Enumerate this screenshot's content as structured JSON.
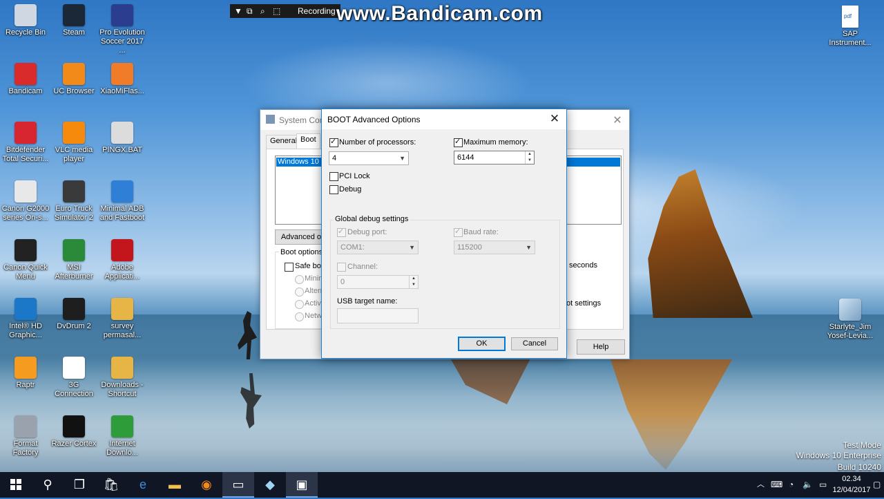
{
  "desktop_icons": [
    {
      "label": "Recycle Bin",
      "icon": "recycle-bin-icon",
      "color": "#cfd8e2"
    },
    {
      "label": "Steam",
      "icon": "steam-icon",
      "color": "#1b2838"
    },
    {
      "label": "Pro Evolution Soccer 2017 ...",
      "icon": "pes-icon",
      "color": "#2b3d8f"
    },
    {
      "label": "Bandicam",
      "icon": "bandicam-icon",
      "color": "#d92b2b"
    },
    {
      "label": "UC Browser",
      "icon": "uc-browser-icon",
      "color": "#f28a1a"
    },
    {
      "label": "XiaoMiFlas...",
      "icon": "xiaomi-icon",
      "color": "#f07c2a"
    },
    {
      "label": "Bitdefender Total Securi...",
      "icon": "bitdefender-icon",
      "color": "#d7262f"
    },
    {
      "label": "VLC media player",
      "icon": "vlc-icon",
      "color": "#f58a0c"
    },
    {
      "label": "PINGX.BAT",
      "icon": "bat-file-icon",
      "color": "#dcdcdc"
    },
    {
      "label": "Canon G2000 series On-s...",
      "icon": "canon-icon",
      "color": "#e8e8e8"
    },
    {
      "label": "Euro Truck Simulator 2",
      "icon": "truck-icon",
      "color": "#3a3a3a"
    },
    {
      "label": "Minimal ADB and Fastboot",
      "icon": "adb-icon",
      "color": "#2f7fd6"
    },
    {
      "label": "Canon Quick Menu",
      "icon": "canon-quick-icon",
      "color": "#222222"
    },
    {
      "label": "MSI Afterburner",
      "icon": "msi-icon",
      "color": "#2a8a3a"
    },
    {
      "label": "Adobe Applicati...",
      "icon": "adobe-icon",
      "color": "#c3161c"
    },
    {
      "label": "Intel® HD Graphic...",
      "icon": "intel-icon",
      "color": "#1b78c8"
    },
    {
      "label": "DvDrum 2",
      "icon": "dvdrum-icon",
      "color": "#1e1e1e"
    },
    {
      "label": "survey permasal...",
      "icon": "folder-icon",
      "color": "#e6b545"
    },
    {
      "label": "Raptr",
      "icon": "raptr-icon",
      "color": "#f59b1f"
    },
    {
      "label": "3G Connection",
      "icon": "3g-icon",
      "color": "#ffffff"
    },
    {
      "label": "Downloads - Shortcut",
      "icon": "downloads-folder-icon",
      "color": "#e6b545"
    },
    {
      "label": "Format Factory",
      "icon": "format-factory-icon",
      "color": "#9aa3ad"
    },
    {
      "label": "Razer Cortex",
      "icon": "razer-icon",
      "color": "#111111"
    },
    {
      "label": "Internet Downlo...",
      "icon": "idm-icon",
      "color": "#2f9c3a"
    }
  ],
  "right_icons": [
    {
      "label": "SAP Instrument...",
      "icon": "pdf-file-icon"
    },
    {
      "label": "Starlyte_Jim Yosef-Levia...",
      "icon": "image-file-icon"
    }
  ],
  "recording": {
    "label": "Recording",
    "watermark": "www.Bandicam.com"
  },
  "sysconfig": {
    "title": "System Conf",
    "tabs": [
      "General",
      "Boot"
    ],
    "os_entry": "Windows 10 (C",
    "advanced_button": "Advanced op",
    "boot_options_label": "Boot options",
    "safe_boot": "Safe boo",
    "radios": [
      "Minima",
      "Altern",
      "Active",
      "Netwo"
    ],
    "seconds_label": "seconds",
    "boot_settings_label": "ot settings",
    "help_button": "Help"
  },
  "boot_dialog": {
    "title": "BOOT Advanced Options",
    "num_processors_label": "Number of processors:",
    "num_processors_checked": true,
    "num_processors_value": "4",
    "max_memory_label": "Maximum memory:",
    "max_memory_checked": true,
    "max_memory_value": "6144",
    "pci_lock_label": "PCI Lock",
    "debug_label": "Debug",
    "global_debug_title": "Global debug settings",
    "debug_port_label": "Debug port:",
    "debug_port_value": "COM1:",
    "baud_rate_label": "Baud rate:",
    "baud_rate_value": "115200",
    "channel_label": "Channel:",
    "channel_value": "0",
    "usb_target_label": "USB target name:",
    "ok_button": "OK",
    "cancel_button": "Cancel"
  },
  "os_watermark": {
    "line1": "Test Mode",
    "line2": "Windows 10 Enterprise",
    "line3": "Build 10240"
  },
  "taskbar": {
    "time": "02.34",
    "date": "12/04/2017"
  }
}
